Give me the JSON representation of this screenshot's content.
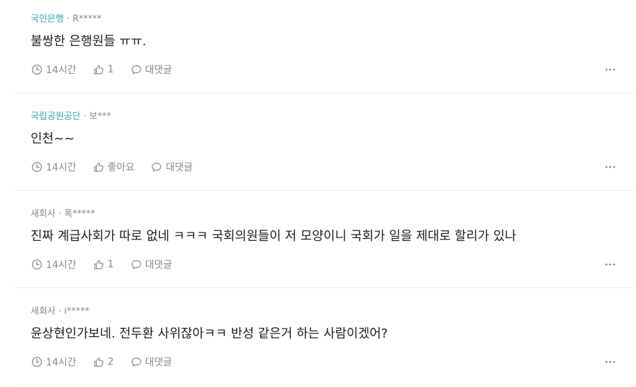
{
  "comments": [
    {
      "org": "국민은행",
      "org_style": "accent",
      "author": " · R*****",
      "text": "불쌍한 은행원들 ㅠㅠ.",
      "time": "14시간",
      "like": "1",
      "reply": "대댓글"
    },
    {
      "org": "국립공원공단",
      "org_style": "accent",
      "author": " · 보***",
      "text": "인천~~",
      "time": "14시간",
      "like": "좋아요",
      "reply": "대댓글"
    },
    {
      "org": "새회사",
      "org_style": "plain",
      "author": " · 폭*****",
      "text": "진짜 계급사회가 따로 없네 ㅋㅋㅋ 국회의원들이 저 모양이니 국회가 일을 제대로 할리가 있나",
      "time": "14시간",
      "like": "1",
      "reply": "대댓글"
    },
    {
      "org": "새회사",
      "org_style": "plain",
      "author": " · i*****",
      "text": "윤상현인가보네. 전두환 사위잖아ㅋㅋ 반성 같은거 하는 사람이겠어?",
      "time": "14시간",
      "like": "2",
      "reply": "대댓글"
    }
  ],
  "colors": {
    "accent": "#3ba3b5",
    "muted": "#888888",
    "text": "#1e1e1e",
    "divider": "#ececec"
  },
  "icons": {
    "time": "clock-icon",
    "like": "thumbs-up-icon",
    "reply": "speech-bubble-icon",
    "more": "more-dots-icon"
  }
}
